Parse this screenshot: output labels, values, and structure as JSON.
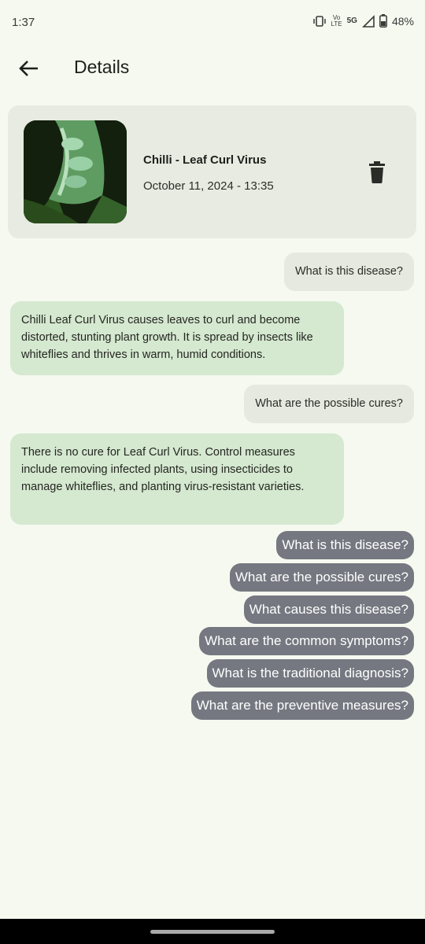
{
  "status_bar": {
    "time": "1:37",
    "network_top": "Vo",
    "network_bottom": "LTE",
    "signal_label": "5G",
    "battery": "48%"
  },
  "app_bar": {
    "title": "Details"
  },
  "diagnosis_card": {
    "title": "Chilli - Leaf Curl Virus",
    "date": "October 11, 2024 - 13:35"
  },
  "chat": {
    "messages": [
      {
        "role": "user",
        "text": "What is this disease?"
      },
      {
        "role": "bot",
        "text": "Chilli Leaf Curl Virus causes leaves to curl and become distorted, stunting plant growth. It is spread by insects like whiteflies and thrives in warm, humid conditions."
      },
      {
        "role": "user",
        "text": "What are the possible cures?"
      },
      {
        "role": "bot",
        "text": "There is no cure for Leaf Curl Virus. Control measures include removing infected plants, using insecticides to manage whiteflies, and planting virus-resistant varieties."
      }
    ]
  },
  "suggestions": [
    "What is this disease?",
    "What are the possible cures?",
    "What causes this disease?",
    "What are the common symptoms?",
    "What is the traditional diagnosis?",
    "What are the preventive measures?"
  ],
  "colors": {
    "background": "#f5f9ef",
    "card": "#e8ebe2",
    "bot_bubble": "#d5e8d0",
    "user_bubble": "#e6e9e0",
    "suggestion_chip": "#757880"
  }
}
